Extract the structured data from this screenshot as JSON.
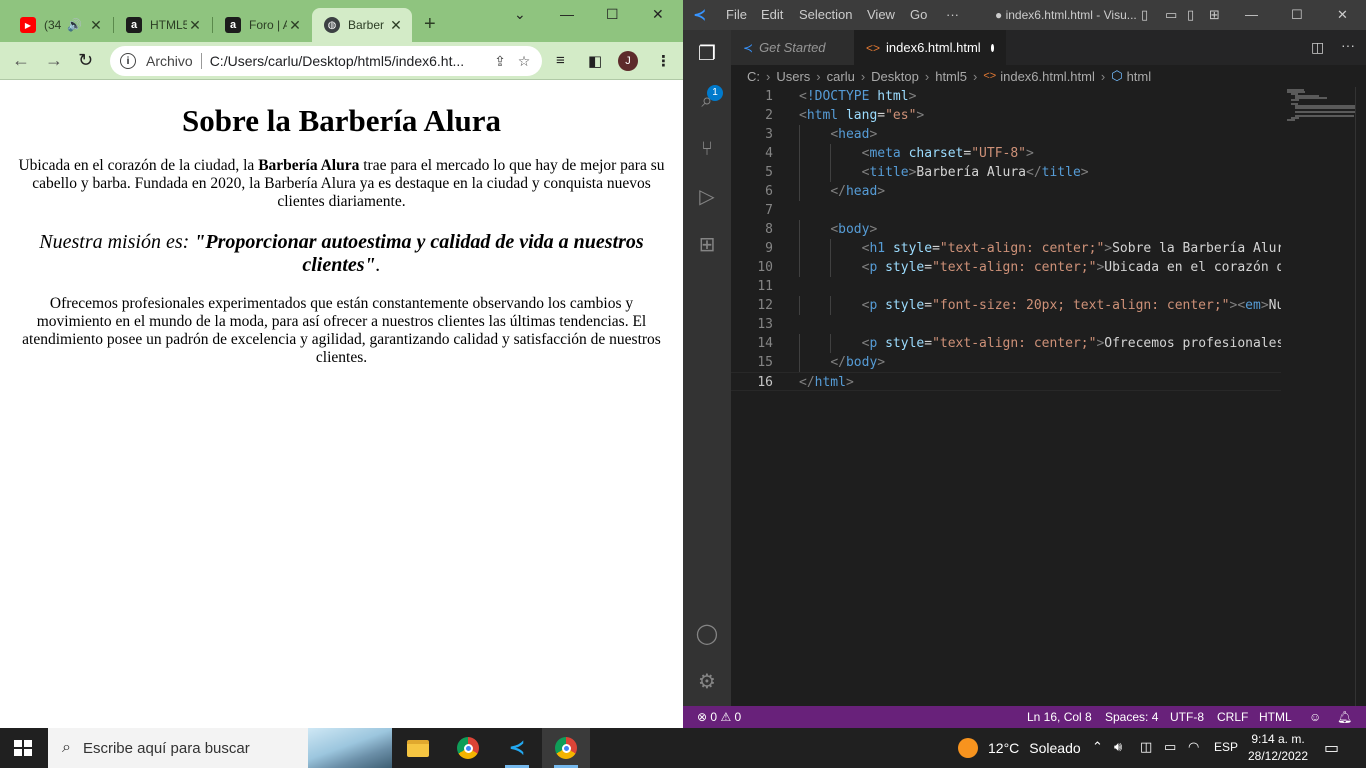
{
  "browser": {
    "tabs": [
      {
        "label": "(34",
        "favicon": "youtube-icon",
        "audio": true,
        "active": false
      },
      {
        "label": "HTML5",
        "favicon": "alura-icon",
        "active": false
      },
      {
        "label": "Foro | A",
        "favicon": "alura-icon",
        "active": false
      },
      {
        "label": "Barber",
        "favicon": "globe-icon",
        "active": true
      }
    ],
    "new_tab": "+",
    "window_controls": {
      "chevron": "⌄",
      "minimize": "—",
      "maximize": "☐",
      "close": "✕"
    },
    "toolbar": {
      "back": "←",
      "forward": "→",
      "reload": "↻",
      "scheme": "Archivo",
      "url": "C:/Users/carlu/Desktop/html5/index6.ht...",
      "avatar_initial": "J"
    },
    "page": {
      "heading": "Sobre la Barbería Alura",
      "intro_before": "Ubicada en el corazón de la ciudad, la ",
      "intro_bold": "Barbería Alura",
      "intro_after": " trae para el mercado lo que hay de mejor para su cabello y barba. Fundada en 2020, la Barbería Alura ya es destaque en la ciudad y conquista nuevos clientes diariamente.",
      "mission_lead": "Nuestra misión es: ",
      "mission_strong": "\"Proporcionar autoestima y calidad de vida a nuestros clientes\"",
      "mission_end": ".",
      "services": "Ofrecemos profesionales experimentados que están constantemente observando los cambios y movimiento en el mundo de la moda, para así ofrecer a nuestros clientes las últimas tendencias. El atendimiento posee un padrón de excelencia y agilidad, garantizando calidad y satisfacción de nuestros clientes."
    }
  },
  "vscode": {
    "menu": [
      "File",
      "Edit",
      "Selection",
      "View",
      "Go",
      "···"
    ],
    "window_title": "● index6.html.html - Visu...",
    "explorer_badge": "1",
    "tabs": [
      {
        "label": "Get Started",
        "active": false
      },
      {
        "label": "index6.html.html",
        "active": true
      }
    ],
    "breadcrumb": [
      "C:",
      "Users",
      "carlu",
      "Desktop",
      "html5",
      "index6.html.html",
      "html"
    ],
    "code_lines": [
      {
        "n": "1",
        "indent": 0,
        "tokens": [
          [
            "p",
            "<"
          ],
          [
            "k",
            "!DOCTYPE"
          ],
          [
            "t",
            " "
          ],
          [
            "a",
            "html"
          ],
          [
            "p",
            ">"
          ]
        ]
      },
      {
        "n": "2",
        "indent": 0,
        "tokens": [
          [
            "p",
            "<"
          ],
          [
            "k",
            "html"
          ],
          [
            "t",
            " "
          ],
          [
            "a",
            "lang"
          ],
          [
            "t",
            "="
          ],
          [
            "s",
            "\"es\""
          ],
          [
            "p",
            ">"
          ]
        ]
      },
      {
        "n": "3",
        "indent": 1,
        "tokens": [
          [
            "p",
            "<"
          ],
          [
            "k",
            "head"
          ],
          [
            "p",
            ">"
          ]
        ]
      },
      {
        "n": "4",
        "indent": 2,
        "tokens": [
          [
            "p",
            "<"
          ],
          [
            "k",
            "meta"
          ],
          [
            "t",
            " "
          ],
          [
            "a",
            "charset"
          ],
          [
            "t",
            "="
          ],
          [
            "s",
            "\"UTF-8\""
          ],
          [
            "p",
            ">"
          ]
        ]
      },
      {
        "n": "5",
        "indent": 2,
        "tokens": [
          [
            "p",
            "<"
          ],
          [
            "k",
            "title"
          ],
          [
            "p",
            ">"
          ],
          [
            "t",
            "Barbería Alura"
          ],
          [
            "p",
            "</"
          ],
          [
            "k",
            "title"
          ],
          [
            "p",
            ">"
          ]
        ]
      },
      {
        "n": "6",
        "indent": 1,
        "tokens": [
          [
            "p",
            "</"
          ],
          [
            "k",
            "head"
          ],
          [
            "p",
            ">"
          ]
        ]
      },
      {
        "n": "7",
        "indent": 0,
        "tokens": []
      },
      {
        "n": "8",
        "indent": 1,
        "tokens": [
          [
            "p",
            "<"
          ],
          [
            "k",
            "body"
          ],
          [
            "p",
            ">"
          ]
        ]
      },
      {
        "n": "9",
        "indent": 2,
        "tokens": [
          [
            "p",
            "<"
          ],
          [
            "k",
            "h1"
          ],
          [
            "t",
            " "
          ],
          [
            "a",
            "style"
          ],
          [
            "t",
            "="
          ],
          [
            "s",
            "\"text-align: center;\""
          ],
          [
            "p",
            ">"
          ],
          [
            "t",
            "Sobre la Barbería Alura"
          ]
        ]
      },
      {
        "n": "10",
        "indent": 2,
        "tokens": [
          [
            "p",
            "<"
          ],
          [
            "k",
            "p"
          ],
          [
            "t",
            " "
          ],
          [
            "a",
            "style"
          ],
          [
            "t",
            "="
          ],
          [
            "s",
            "\"text-align: center;\""
          ],
          [
            "p",
            ">"
          ],
          [
            "t",
            "Ubicada en el corazón de"
          ]
        ]
      },
      {
        "n": "11",
        "indent": 0,
        "tokens": []
      },
      {
        "n": "12",
        "indent": 2,
        "tokens": [
          [
            "p",
            "<"
          ],
          [
            "k",
            "p"
          ],
          [
            "t",
            " "
          ],
          [
            "a",
            "style"
          ],
          [
            "t",
            "="
          ],
          [
            "s",
            "\"font-size: 20px; text-align: center;\""
          ],
          [
            "p",
            ">"
          ],
          [
            "p",
            "<"
          ],
          [
            "k",
            "em"
          ],
          [
            "p",
            ">"
          ],
          [
            "t",
            "Nue"
          ]
        ]
      },
      {
        "n": "13",
        "indent": 0,
        "tokens": []
      },
      {
        "n": "14",
        "indent": 2,
        "tokens": [
          [
            "p",
            "<"
          ],
          [
            "k",
            "p"
          ],
          [
            "t",
            " "
          ],
          [
            "a",
            "style"
          ],
          [
            "t",
            "="
          ],
          [
            "s",
            "\"text-align: center;\""
          ],
          [
            "p",
            ">"
          ],
          [
            "t",
            "Ofrecemos profesionales"
          ]
        ]
      },
      {
        "n": "15",
        "indent": 1,
        "tokens": [
          [
            "p",
            "</"
          ],
          [
            "k",
            "body"
          ],
          [
            "p",
            ">"
          ]
        ]
      },
      {
        "n": "16",
        "indent": 0,
        "tokens": [
          [
            "p",
            "</"
          ],
          [
            "k",
            "html"
          ],
          [
            "p",
            ">"
          ]
        ]
      }
    ],
    "status": {
      "errors": "0",
      "warnings": "0",
      "position": "Ln 16, Col 8",
      "spaces": "Spaces: 4",
      "encoding": "UTF-8",
      "eol": "CRLF",
      "language": "HTML"
    }
  },
  "taskbar": {
    "search_placeholder": "Escribe aquí para buscar",
    "weather_temp": "12°C",
    "weather_desc": "Soleado",
    "language": "ESP",
    "time": "9:14 a. m.",
    "date": "28/12/2022"
  },
  "colors": {
    "chrome_tabstrip": "#8fc47f",
    "chrome_toolbar": "#d3ebc7",
    "vscode_statusbar": "#68217a",
    "vscode_accent": "#007acc"
  }
}
